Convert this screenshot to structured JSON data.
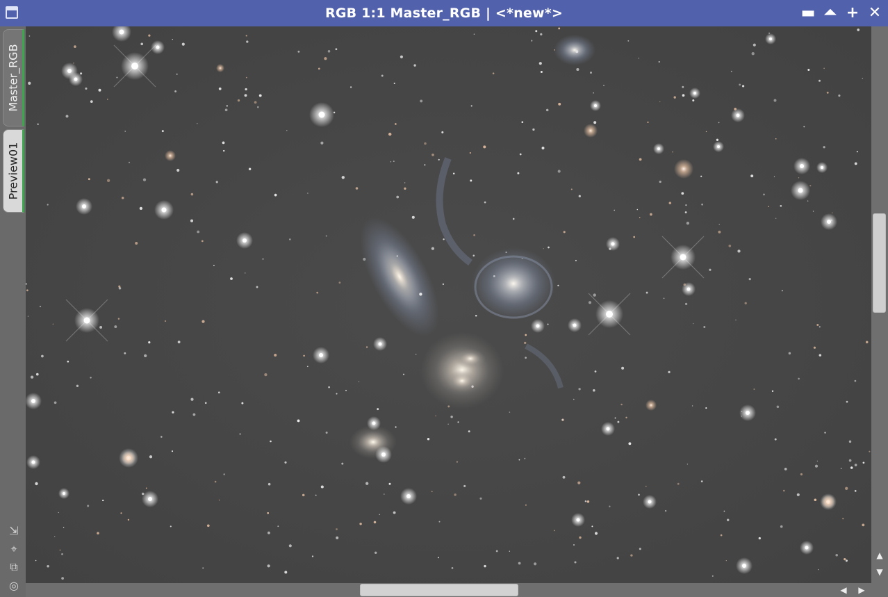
{
  "window": {
    "title": "RGB 1:1 Master_RGB | <*new*>",
    "controls": {
      "minimize": "▬",
      "maximize": "⏶",
      "restore": "+",
      "close": "✕"
    }
  },
  "tabs": [
    {
      "label": "Master_RGB",
      "active": true
    },
    {
      "label": "Preview01",
      "active": false
    }
  ],
  "tools": [
    {
      "icon": "shrink-icon",
      "glyph": "⇲"
    },
    {
      "icon": "fit-icon",
      "glyph": "⌖"
    },
    {
      "icon": "clone-icon",
      "glyph": "⧉"
    },
    {
      "icon": "target-icon",
      "glyph": "◎"
    }
  ],
  "image": {
    "subject": "Stephan's Quintet",
    "colors": {
      "sky": "#454545",
      "star": "#ffffff",
      "warm_star": "#f2c9a8",
      "galaxy_core": "#e8e0d4",
      "galaxy_arm": "#9fb1d3"
    }
  },
  "scrollbars": {
    "vertical": {
      "up": "▲",
      "down": "▼"
    },
    "horizontal": {
      "left": "◀",
      "right": "▶"
    }
  },
  "colors": {
    "titlebar": "#5161ab",
    "tab_active_marker": "#3fa54d"
  }
}
